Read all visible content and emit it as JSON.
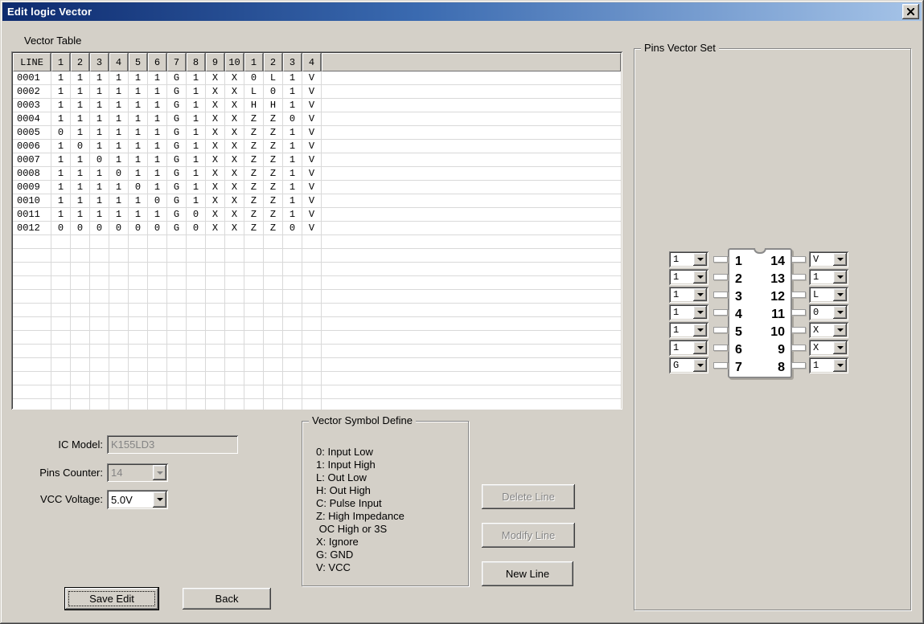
{
  "window": {
    "title": "Edit logic Vector"
  },
  "colors": {
    "dialog_bg": "#d4d0c8",
    "titlebar_left": "#0d2a6e",
    "titlebar_right": "#a6c4e8",
    "grid_line": "#d9d9d9",
    "disabled_text": "#848484"
  },
  "table": {
    "section_label": "Vector Table",
    "headers": [
      "LINE",
      "1",
      "2",
      "3",
      "4",
      "5",
      "6",
      "7",
      "8",
      "9",
      "10",
      "1",
      "2",
      "3",
      "4"
    ],
    "rows": [
      {
        "line": "0001",
        "values": [
          "1",
          "1",
          "1",
          "1",
          "1",
          "1",
          "G",
          "1",
          "X",
          "X",
          "0",
          "L",
          "1",
          "V"
        ]
      },
      {
        "line": "0002",
        "values": [
          "1",
          "1",
          "1",
          "1",
          "1",
          "1",
          "G",
          "1",
          "X",
          "X",
          "L",
          "0",
          "1",
          "V"
        ]
      },
      {
        "line": "0003",
        "values": [
          "1",
          "1",
          "1",
          "1",
          "1",
          "1",
          "G",
          "1",
          "X",
          "X",
          "H",
          "H",
          "1",
          "V"
        ]
      },
      {
        "line": "0004",
        "values": [
          "1",
          "1",
          "1",
          "1",
          "1",
          "1",
          "G",
          "1",
          "X",
          "X",
          "Z",
          "Z",
          "0",
          "V"
        ]
      },
      {
        "line": "0005",
        "values": [
          "0",
          "1",
          "1",
          "1",
          "1",
          "1",
          "G",
          "1",
          "X",
          "X",
          "Z",
          "Z",
          "1",
          "V"
        ]
      },
      {
        "line": "0006",
        "values": [
          "1",
          "0",
          "1",
          "1",
          "1",
          "1",
          "G",
          "1",
          "X",
          "X",
          "Z",
          "Z",
          "1",
          "V"
        ]
      },
      {
        "line": "0007",
        "values": [
          "1",
          "1",
          "0",
          "1",
          "1",
          "1",
          "G",
          "1",
          "X",
          "X",
          "Z",
          "Z",
          "1",
          "V"
        ]
      },
      {
        "line": "0008",
        "values": [
          "1",
          "1",
          "1",
          "0",
          "1",
          "1",
          "G",
          "1",
          "X",
          "X",
          "Z",
          "Z",
          "1",
          "V"
        ]
      },
      {
        "line": "0009",
        "values": [
          "1",
          "1",
          "1",
          "1",
          "0",
          "1",
          "G",
          "1",
          "X",
          "X",
          "Z",
          "Z",
          "1",
          "V"
        ]
      },
      {
        "line": "0010",
        "values": [
          "1",
          "1",
          "1",
          "1",
          "1",
          "0",
          "G",
          "1",
          "X",
          "X",
          "Z",
          "Z",
          "1",
          "V"
        ]
      },
      {
        "line": "0011",
        "values": [
          "1",
          "1",
          "1",
          "1",
          "1",
          "1",
          "G",
          "0",
          "X",
          "X",
          "Z",
          "Z",
          "1",
          "V"
        ]
      },
      {
        "line": "0012",
        "values": [
          "0",
          "0",
          "0",
          "0",
          "0",
          "0",
          "G",
          "0",
          "X",
          "X",
          "Z",
          "Z",
          "0",
          "V"
        ]
      }
    ]
  },
  "form": {
    "ic_model_label": "IC Model:",
    "ic_model_value": "K155LD3",
    "pins_counter_label": "Pins Counter:",
    "pins_counter_value": "14",
    "vcc_voltage_label": "VCC Voltage:",
    "vcc_voltage_value": "5.0V"
  },
  "symbol_define": {
    "title": "Vector Symbol Define",
    "lines": [
      "0: Input Low",
      "1: Input High",
      "L: Out Low",
      "H: Out High",
      "C: Pulse Input",
      "Z: High Impedance",
      " OC High or 3S",
      "X: Ignore",
      "G: GND",
      "V: VCC"
    ]
  },
  "buttons": {
    "delete_line": "Delete Line",
    "modify_line": "Modify Line",
    "new_line": "New Line",
    "save_edit": "Save Edit",
    "back": "Back"
  },
  "pins_vector_set": {
    "title": "Pins Vector Set",
    "left_pins": [
      {
        "pin": "1",
        "value": "1"
      },
      {
        "pin": "2",
        "value": "1"
      },
      {
        "pin": "3",
        "value": "1"
      },
      {
        "pin": "4",
        "value": "1"
      },
      {
        "pin": "5",
        "value": "1"
      },
      {
        "pin": "6",
        "value": "1"
      },
      {
        "pin": "7",
        "value": "G"
      }
    ],
    "right_pins": [
      {
        "pin": "14",
        "value": "V"
      },
      {
        "pin": "13",
        "value": "1"
      },
      {
        "pin": "12",
        "value": "L"
      },
      {
        "pin": "11",
        "value": "0"
      },
      {
        "pin": "10",
        "value": "X"
      },
      {
        "pin": "9",
        "value": "X"
      },
      {
        "pin": "8",
        "value": "1"
      }
    ]
  }
}
